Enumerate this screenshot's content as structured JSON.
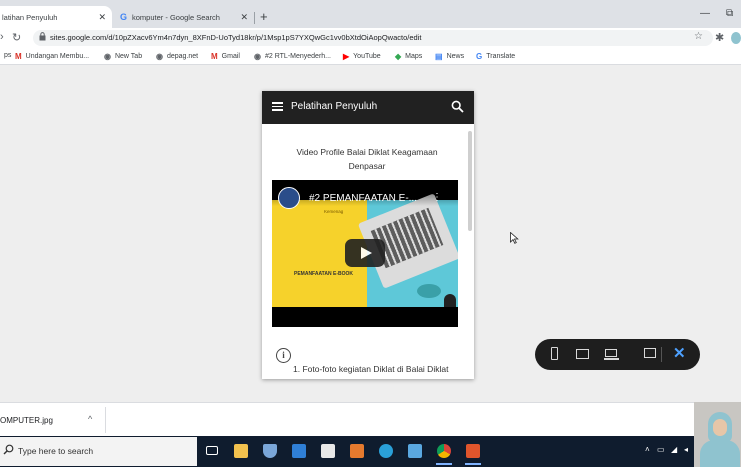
{
  "browser": {
    "tabs": [
      {
        "title": "latihan Penyuluh",
        "active": true
      },
      {
        "title": "komputer - Google Search",
        "favicon": "G",
        "active": false
      }
    ],
    "window_controls": {
      "restore": "⧉",
      "minimize": "—"
    },
    "url": "sites.google.com/d/10pZXacv6Ym4n7dyn_8XFnD-UoTyd18kr/p/1Msp1pS7YXQwGc1vv0bXtdOiAopQwacto/edit",
    "bookmarks": [
      {
        "label": "ps",
        "icon": "apps-icon"
      },
      {
        "label": "Undangan Membu...",
        "icon": "gmail-icon"
      },
      {
        "label": "New Tab",
        "icon": "globe-icon"
      },
      {
        "label": "depag.net",
        "icon": "globe-icon"
      },
      {
        "label": "Gmail",
        "icon": "gmail-icon"
      },
      {
        "label": "#2 RTL-Menyederh...",
        "icon": "globe-icon"
      },
      {
        "label": "YouTube",
        "icon": "youtube-icon"
      },
      {
        "label": "Maps",
        "icon": "maps-icon"
      },
      {
        "label": "News",
        "icon": "news-icon"
      },
      {
        "label": "Translate",
        "icon": "translate-icon"
      }
    ]
  },
  "site": {
    "title": "Pelatihan Penyuluh",
    "heading": "Video Profile Balai Diklat Keagamaan Denpasar",
    "video": {
      "title": "#2 PEMANFAATAN E-...",
      "channel_text": "Kemenag",
      "caption": "PEMANFAATAN E-BOOK"
    },
    "list_item": "1. Foto-foto kegiatan Diklat di Balai Diklat",
    "info_icon": "i"
  },
  "device_preview": {
    "buttons": [
      "phone-icon",
      "tablet-icon",
      "laptop-icon",
      "comment-icon",
      "close-icon"
    ],
    "close_glyph": "✕",
    "accent": "#4ea1ff"
  },
  "downloads": {
    "file": "OMPUTER.jpg",
    "chevron": "^"
  },
  "taskbar": {
    "search_placeholder": "Type here to search",
    "apps": [
      "task-view-icon",
      "file-explorer-icon",
      "ship-icon",
      "mail-icon",
      "store-icon",
      "puzzle-icon",
      "edge-icon",
      "screen-icon",
      "chrome-icon",
      "red-app-icon"
    ]
  }
}
